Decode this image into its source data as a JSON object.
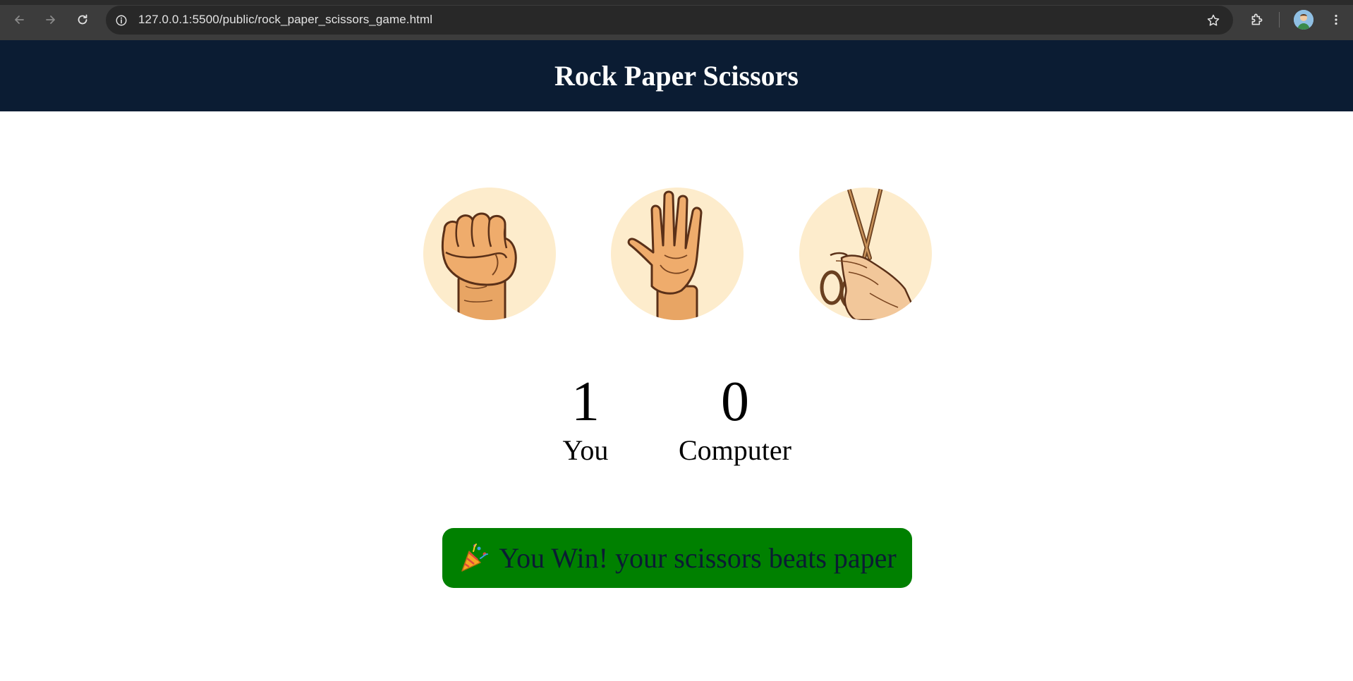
{
  "browser": {
    "url": "127.0.0.1:5500/public/rock_paper_scissors_game.html"
  },
  "header": {
    "title": "Rock Paper Scissors"
  },
  "choices": [
    {
      "name": "rock",
      "icon": "fist-hand-icon"
    },
    {
      "name": "paper",
      "icon": "open-hand-icon"
    },
    {
      "name": "scissors",
      "icon": "scissors-hand-icon"
    }
  ],
  "score": {
    "user_value": "1",
    "user_label": "You",
    "computer_value": "0",
    "computer_label": "Computer"
  },
  "result": {
    "icon": "party-popper-icon",
    "text": "You Win! your scissors beats paper",
    "background": "#008000"
  },
  "colors": {
    "header_bg": "#0b1c33",
    "choice_circle_bg": "#fdeccc"
  }
}
